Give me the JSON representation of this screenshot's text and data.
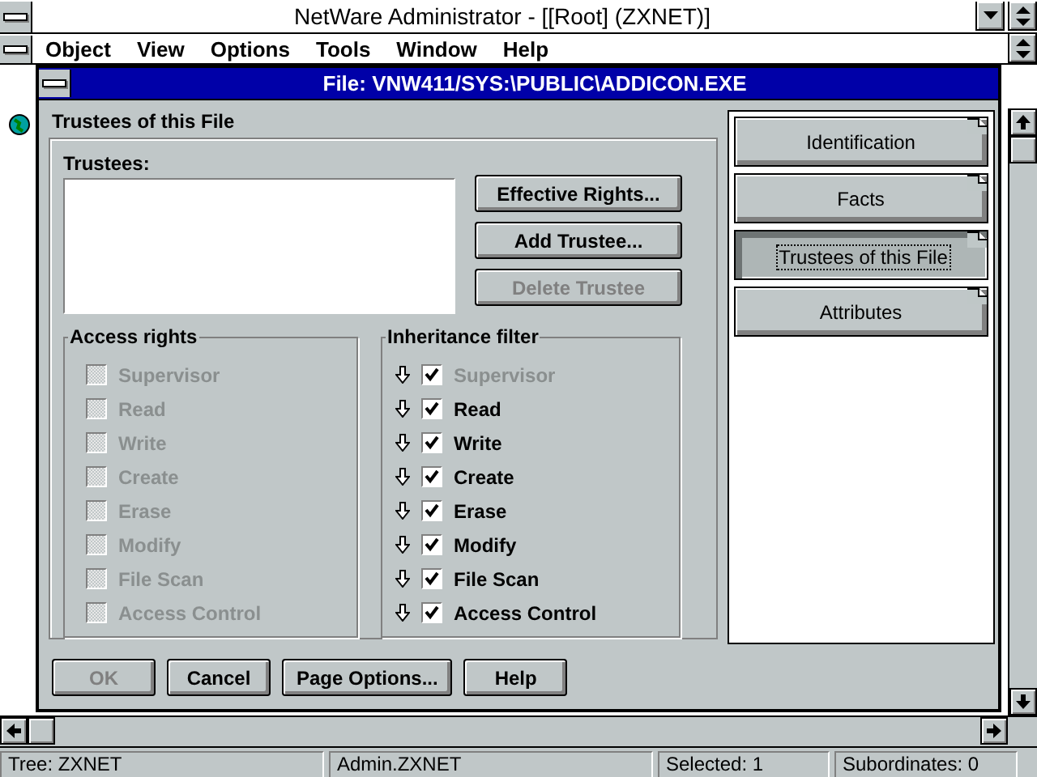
{
  "window": {
    "title": "NetWare Administrator - [[Root] (ZXNET)]"
  },
  "menu": [
    "Object",
    "View",
    "Options",
    "Tools",
    "Window",
    "Help"
  ],
  "dialog": {
    "title": "File: VNW411/SYS:\\PUBLIC\\ADDICON.EXE",
    "page_title": "Trustees of this File",
    "trustees_label": "Trustees:",
    "side_buttons": [
      {
        "label": "Effective Rights...",
        "disabled": false
      },
      {
        "label": "Add Trustee...",
        "disabled": false
      },
      {
        "label": "Delete Trustee",
        "disabled": true
      }
    ],
    "access_rights": {
      "title": "Access rights",
      "items": [
        {
          "label": "Supervisor",
          "checked": false,
          "disabled": true
        },
        {
          "label": "Read",
          "checked": false,
          "disabled": true
        },
        {
          "label": "Write",
          "checked": false,
          "disabled": true
        },
        {
          "label": "Create",
          "checked": false,
          "disabled": true
        },
        {
          "label": "Erase",
          "checked": false,
          "disabled": true
        },
        {
          "label": "Modify",
          "checked": false,
          "disabled": true
        },
        {
          "label": "File Scan",
          "checked": false,
          "disabled": true
        },
        {
          "label": "Access Control",
          "checked": false,
          "disabled": true
        }
      ]
    },
    "inheritance_filter": {
      "title": "Inheritance filter",
      "items": [
        {
          "label": "Supervisor",
          "checked": true,
          "disabled": true
        },
        {
          "label": "Read",
          "checked": true,
          "disabled": false
        },
        {
          "label": "Write",
          "checked": true,
          "disabled": false
        },
        {
          "label": "Create",
          "checked": true,
          "disabled": false
        },
        {
          "label": "Erase",
          "checked": true,
          "disabled": false
        },
        {
          "label": "Modify",
          "checked": true,
          "disabled": false
        },
        {
          "label": "File Scan",
          "checked": true,
          "disabled": false
        },
        {
          "label": "Access Control",
          "checked": true,
          "disabled": false
        }
      ]
    },
    "pages": [
      {
        "label": "Identification",
        "selected": false
      },
      {
        "label": "Facts",
        "selected": false
      },
      {
        "label": "Trustees of this File",
        "selected": true
      },
      {
        "label": "Attributes",
        "selected": false
      }
    ],
    "buttons": [
      {
        "label": "OK",
        "disabled": true
      },
      {
        "label": "Cancel",
        "disabled": false
      },
      {
        "label": "Page Options...",
        "disabled": false
      },
      {
        "label": "Help",
        "disabled": false
      }
    ]
  },
  "status_bar": [
    "Tree: ZXNET",
    "Admin.ZXNET",
    "Selected: 1",
    "Subordinates: 0"
  ]
}
